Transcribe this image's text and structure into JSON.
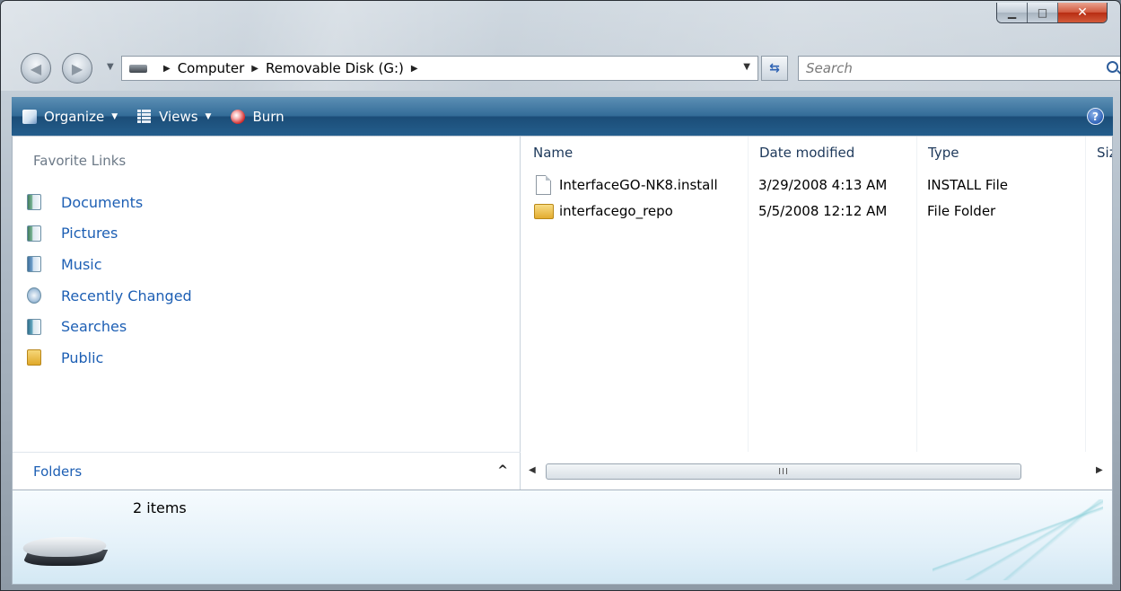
{
  "window": {
    "controls": {
      "minimize": "▁",
      "maximize": "□",
      "close": "✕"
    }
  },
  "nav": {
    "back_icon": "back-arrow-icon",
    "forward_icon": "forward-arrow-icon",
    "breadcrumb": [
      "Computer",
      "Removable Disk (G:)"
    ],
    "search_placeholder": "Search"
  },
  "toolbar": {
    "organize_label": "Organize",
    "views_label": "Views",
    "burn_label": "Burn",
    "help_label": "?"
  },
  "sidebar": {
    "favorites_title": "Favorite Links",
    "items": [
      {
        "label": "Documents",
        "icon": "documents-icon"
      },
      {
        "label": "Pictures",
        "icon": "pictures-icon"
      },
      {
        "label": "Music",
        "icon": "music-icon"
      },
      {
        "label": "Recently Changed",
        "icon": "recently-changed-icon"
      },
      {
        "label": "Searches",
        "icon": "searches-icon"
      },
      {
        "label": "Public",
        "icon": "public-folder-icon"
      }
    ],
    "folders_label": "Folders",
    "folders_chevron": "^"
  },
  "file_list": {
    "columns": [
      "Name",
      "Date modified",
      "Type",
      "Siz"
    ],
    "rows": [
      {
        "name": "InterfaceGO-NK8.install",
        "date": "3/29/2008 4:13 AM",
        "type": "INSTALL File",
        "icon": "file-icon"
      },
      {
        "name": "interfacego_repo",
        "date": "5/5/2008 12:12 AM",
        "type": "File Folder",
        "icon": "folder-icon"
      }
    ],
    "scroll_grip": "III"
  },
  "details": {
    "item_count": "2 items",
    "icon": "removable-drive-icon"
  },
  "colors": {
    "toolbar_blue": "#245e8c",
    "link_blue": "#1d5fb4",
    "header_text": "#1e395b"
  }
}
